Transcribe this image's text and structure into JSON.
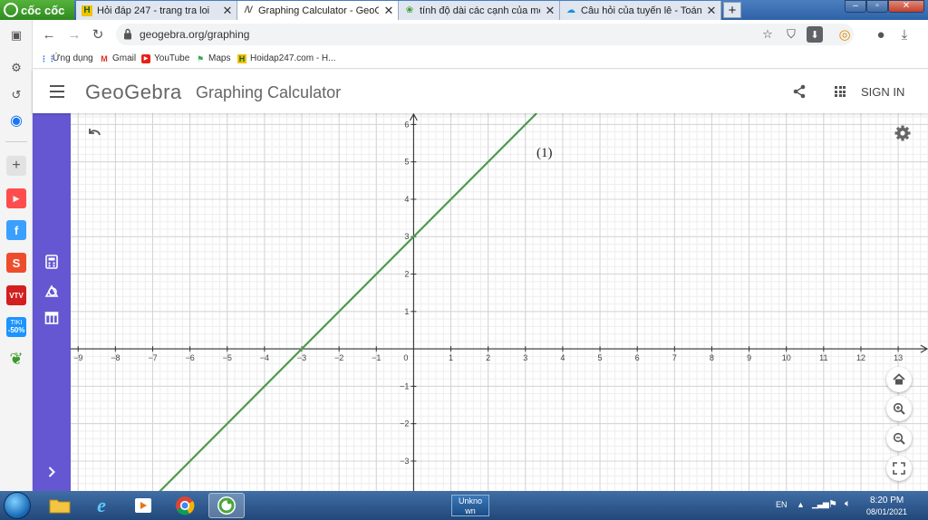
{
  "browser": {
    "brand": "cốc cốc",
    "tabs": [
      {
        "label": "Hỏi đáp 247 - trang tra loi",
        "icon": "hoidap-icon",
        "active": false
      },
      {
        "label": "Graphing Calculator - GeoGe",
        "icon": "geogebra-tab-icon",
        "active": true
      },
      {
        "label": "tính độ dài các cạnh của một",
        "icon": "coccoc-search-icon",
        "active": false
      },
      {
        "label": "Câu hỏi của tuyến lê - Toán lớ",
        "icon": "cloud-icon",
        "active": false
      }
    ],
    "new_tab": "+",
    "url": "geogebra.org/graphing",
    "bookmarks": [
      {
        "label": "Ứng dụng",
        "icon": "apps-grid-icon"
      },
      {
        "label": "Gmail",
        "icon": "gmail-icon"
      },
      {
        "label": "YouTube",
        "icon": "youtube-icon"
      },
      {
        "label": "Maps",
        "icon": "maps-icon"
      },
      {
        "label": "Hoidap247.com - H...",
        "icon": "hoidap-icon"
      }
    ],
    "sidebar": {
      "badge_tiki": "TIKI",
      "badge_discount": "-50%"
    }
  },
  "geogebra": {
    "logo": "GeoGebra",
    "title": "Graphing Calculator",
    "sign_in": "SIGN IN",
    "line_label": "(1)",
    "line_color": "#4e9a52",
    "accent": "#6557d2"
  },
  "chart_data": {
    "type": "line",
    "title": "",
    "xlabel": "",
    "ylabel": "",
    "xlim": [
      -9.2,
      13.8
    ],
    "ylim": [
      -3.8,
      6.3
    ],
    "x_ticks": [
      -9,
      -8,
      -7,
      -6,
      -5,
      -4,
      -3,
      -2,
      -1,
      1,
      2,
      3,
      4,
      5,
      6,
      7,
      8,
      9,
      10,
      11,
      12,
      13
    ],
    "y_ticks": [
      -3,
      -2,
      -1,
      1,
      2,
      3,
      4,
      5,
      6
    ],
    "origin_label": "0",
    "grid": true,
    "series": [
      {
        "x": [
          -7.0,
          3.3
        ],
        "y": [
          -4.0,
          6.3
        ]
      }
    ]
  },
  "taskbar": {
    "unknown_task": "Unkno wn",
    "language": "EN",
    "time": "8:20 PM",
    "date": "08/01/2021"
  }
}
